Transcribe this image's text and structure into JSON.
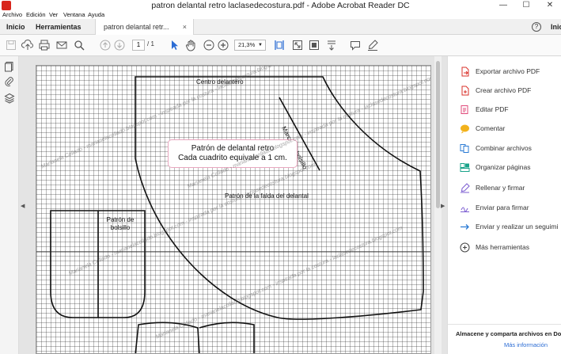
{
  "window": {
    "title": "patron delantal retro laclasedecostura.pdf - Adobe Acrobat Reader DC",
    "minimize": "—",
    "maximize": "☐",
    "close": "✕"
  },
  "menu": {
    "items": [
      "Archivo",
      "Edición",
      "Ver",
      "Ventana",
      "Ayuda"
    ]
  },
  "tabs": {
    "home": "Inicio",
    "tools": "Herramientas",
    "document": "patron delantal retr...",
    "close": "×",
    "help": "?",
    "signin": "Inic"
  },
  "toolbar": {
    "current_page": "1",
    "total_pages": "/ 1",
    "zoom": "21,3%",
    "icons": [
      "save-icon",
      "upload-icon",
      "print-icon",
      "mail-icon",
      "search-icon",
      "page-up-icon",
      "page-down-icon",
      "select-arrow-icon",
      "hand-icon",
      "zoom-out-icon",
      "zoom-in-icon",
      "fit-page-icon",
      "fullscreen-icon",
      "scroll-mode-icon",
      "comment-icon",
      "sign-icon"
    ]
  },
  "document": {
    "label_front": "Centro delantero",
    "label_pocket_mark": "Marca de bolsillo",
    "label_skirt": "Patrón de la falda del delantal",
    "label_pocket": "Patrón de bolsillo",
    "info_line1": "Patrón de delantal retro",
    "info_line2": "Cada cuadrito equivale a 1 cm.",
    "watermark": "Marianela Collado - marianelacollado.blogspot.com - inspirada por la costura - laclasedecostura.blogspot.com"
  },
  "right_panel": {
    "tools": [
      {
        "label": "Exportar archivo PDF",
        "icon": "export-pdf-icon",
        "color": "#d9302a"
      },
      {
        "label": "Crear archivo PDF",
        "icon": "create-pdf-icon",
        "color": "#d9302a"
      },
      {
        "label": "Editar PDF",
        "icon": "edit-pdf-icon",
        "color": "#e0487a"
      },
      {
        "label": "Comentar",
        "icon": "comment-icon",
        "color": "#f2b21c"
      },
      {
        "label": "Combinar archivos",
        "icon": "combine-files-icon",
        "color": "#2b7bd4"
      },
      {
        "label": "Organizar páginas",
        "icon": "organize-pages-icon",
        "color": "#1aa38a"
      },
      {
        "label": "Rellenar y firmar",
        "icon": "fill-sign-icon",
        "color": "#7b5cd1"
      },
      {
        "label": "Enviar para firmar",
        "icon": "send-sign-icon",
        "color": "#7b5cd1"
      },
      {
        "label": "Enviar y realizar un seguimi",
        "icon": "send-track-icon",
        "color": "#2b7bd4"
      },
      {
        "label": "Más herramientas",
        "icon": "more-tools-icon",
        "color": "#444444"
      }
    ],
    "store_title": "Almacene y comparta archivos en Docu",
    "store_link": "Más información"
  },
  "colors": {
    "accent_blue": "#2b6cd4",
    "info_border": "#e9a7bf",
    "acrobat_red": "#d8261c"
  }
}
